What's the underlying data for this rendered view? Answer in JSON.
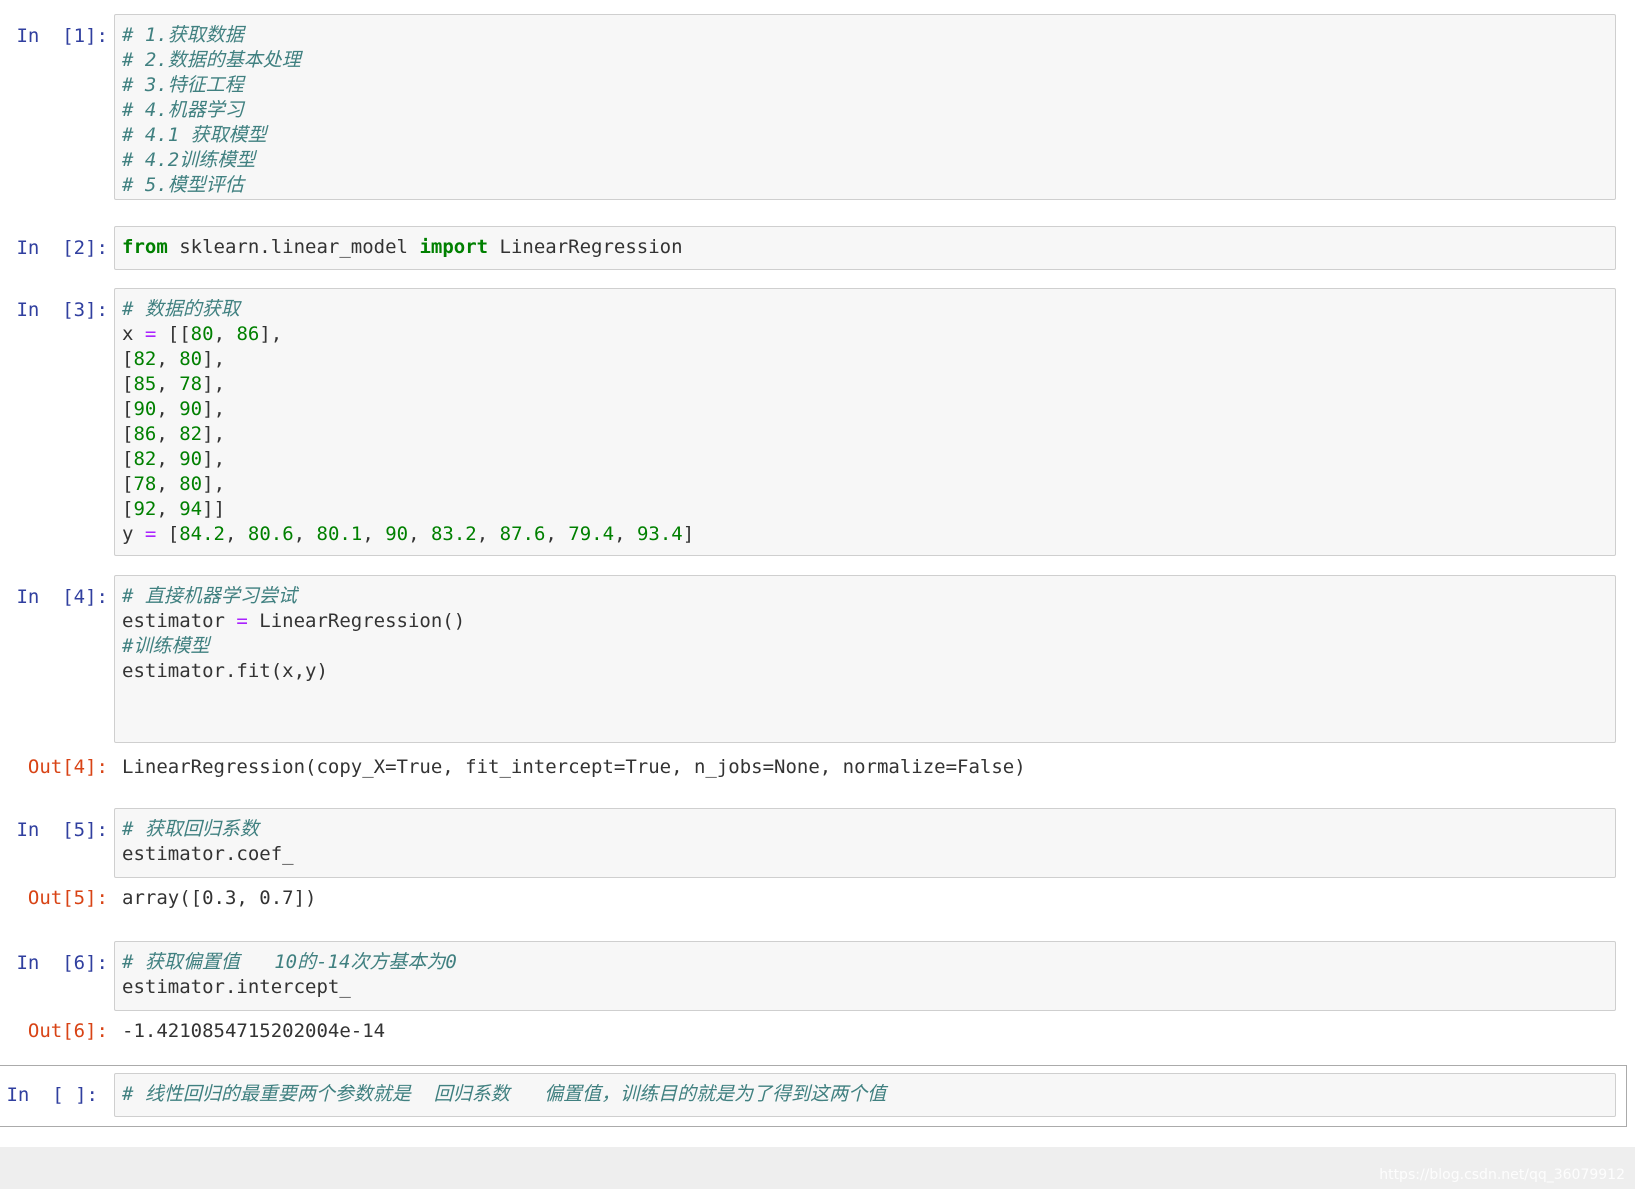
{
  "cells": [
    {
      "prompt": "In  [1]:",
      "lines": [
        "# 1.获取数据",
        "# 2.数据的基本处理",
        "# 3.特征工程",
        "# 4.机器学习",
        "# 4.1 获取模型",
        "# 4.2训练模型",
        "# 5.模型评估"
      ]
    },
    {
      "prompt": "In  [2]:",
      "line": {
        "kw1": "from",
        "text1": " sklearn.linear_model ",
        "kw2": "import",
        "text2": " LinearRegression"
      }
    },
    {
      "prompt": "In  [3]:",
      "comment": "# 数据的获取",
      "x_var": "x",
      "y_var": "y",
      "x_values": [
        [
          "80",
          "86"
        ],
        [
          "82",
          "80"
        ],
        [
          "85",
          "78"
        ],
        [
          "90",
          "90"
        ],
        [
          "86",
          "82"
        ],
        [
          "82",
          "90"
        ],
        [
          "78",
          "80"
        ],
        [
          "92",
          "94"
        ]
      ],
      "y_values": [
        "84.2",
        "80.6",
        "80.1",
        "90",
        "83.2",
        "87.6",
        "79.4",
        "93.4"
      ]
    },
    {
      "prompt": "In  [4]:",
      "comment1": "# 直接机器学习尝试",
      "line2_left": "estimator ",
      "line2_right": " LinearRegression()",
      "comment3": "#训练模型",
      "line4": "estimator.fit(x,y)",
      "out_prompt": "Out[4]:",
      "output": "LinearRegression(copy_X=True, fit_intercept=True, n_jobs=None, normalize=False)"
    },
    {
      "prompt": "In  [5]:",
      "comment1": "# 获取回归系数",
      "line2": "estimator.coef_",
      "out_prompt": "Out[5]:",
      "output": "array([0.3, 0.7])"
    },
    {
      "prompt": "In  [6]:",
      "comment1": "# 获取偏置值   10的-14次方基本为0",
      "line2": "estimator.intercept_",
      "out_prompt": "Out[6]:",
      "output": "-1.4210854715202004e-14"
    },
    {
      "prompt": "In  [ ]:",
      "comment1": "# 线性回归的最重要两个参数就是  回归系数   偏置值，训练目的就是为了得到这两个值"
    }
  ],
  "watermark": "https://blog.csdn.net/qq_36079912"
}
